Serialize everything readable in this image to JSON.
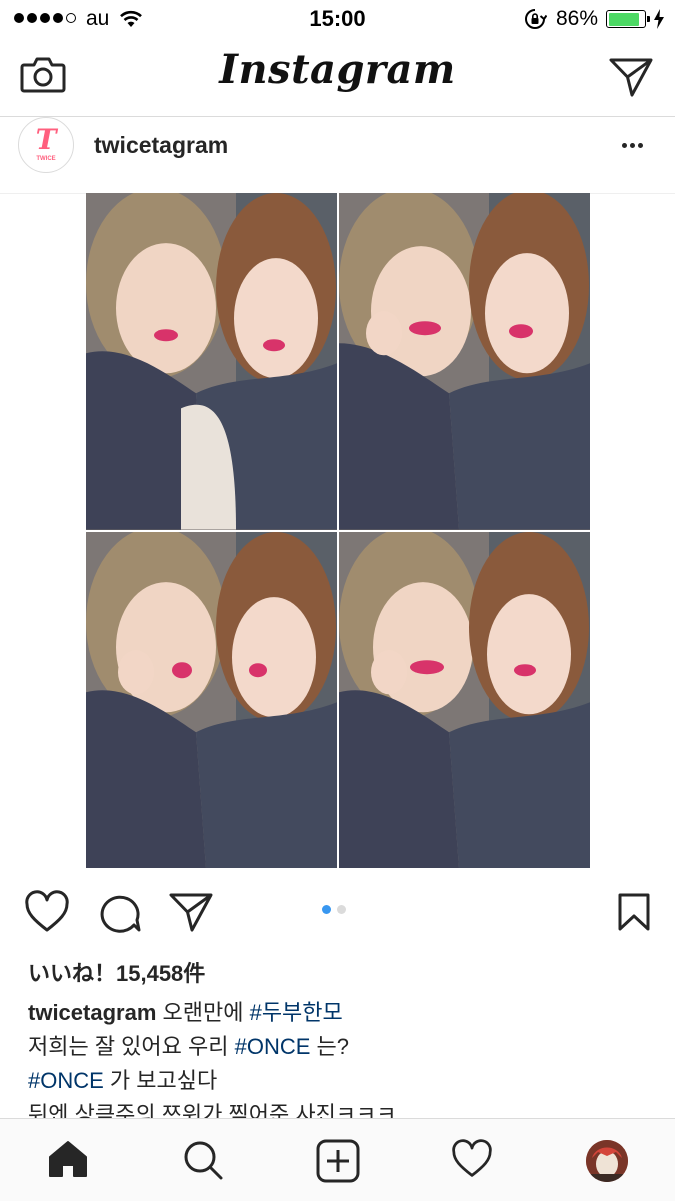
{
  "status_bar": {
    "carrier": "au",
    "time": "15:00",
    "battery_percent": "86%",
    "battery_level": 0.86,
    "battery_color": "#4cd964",
    "signal_bars_filled": 4,
    "signal_bars_total": 5
  },
  "nav": {
    "brand": "Instagram",
    "left_icon": "camera-icon",
    "right_icon": "direct-message-icon"
  },
  "post": {
    "username": "twicetagram",
    "avatar_logo": "T",
    "avatar_logo_sub": "TWICE",
    "likes_text": "いいね！15,458件",
    "carousel": {
      "total": 2,
      "active_index": 0,
      "active_color": "#3897f0"
    },
    "caption": {
      "lines": [
        [
          {
            "text": "twicetagram",
            "kind": "user"
          },
          {
            "text": " 오랜만에 ",
            "kind": "text"
          },
          {
            "text": "#두부한모",
            "kind": "tag"
          }
        ],
        [
          {
            "text": "저희는 잘 있어요 우리 ",
            "kind": "text"
          },
          {
            "text": "#ONCE",
            "kind": "tag"
          },
          {
            "text": " 는?",
            "kind": "text"
          }
        ],
        [
          {
            "text": "#ONCE",
            "kind": "tag"
          },
          {
            "text": " 가 보고싶다",
            "kind": "text"
          }
        ],
        [
          {
            "text": "뒤엔 상큼주의 쯔위가 찍어준 사진ㅋㅋㅋ",
            "kind": "text"
          }
        ]
      ]
    },
    "actions": [
      "heart-icon",
      "comment-icon",
      "share-icon",
      "bookmark-icon"
    ]
  },
  "tab_bar": {
    "tabs": [
      "home-icon",
      "search-icon",
      "add-post-icon",
      "activity-heart-icon",
      "profile-avatar"
    ],
    "active": "home-icon"
  },
  "colors": {
    "hashtag": "#003569",
    "text": "#262626",
    "divider": "#dbdbdb",
    "logo_pink": "#ff5f7e"
  }
}
